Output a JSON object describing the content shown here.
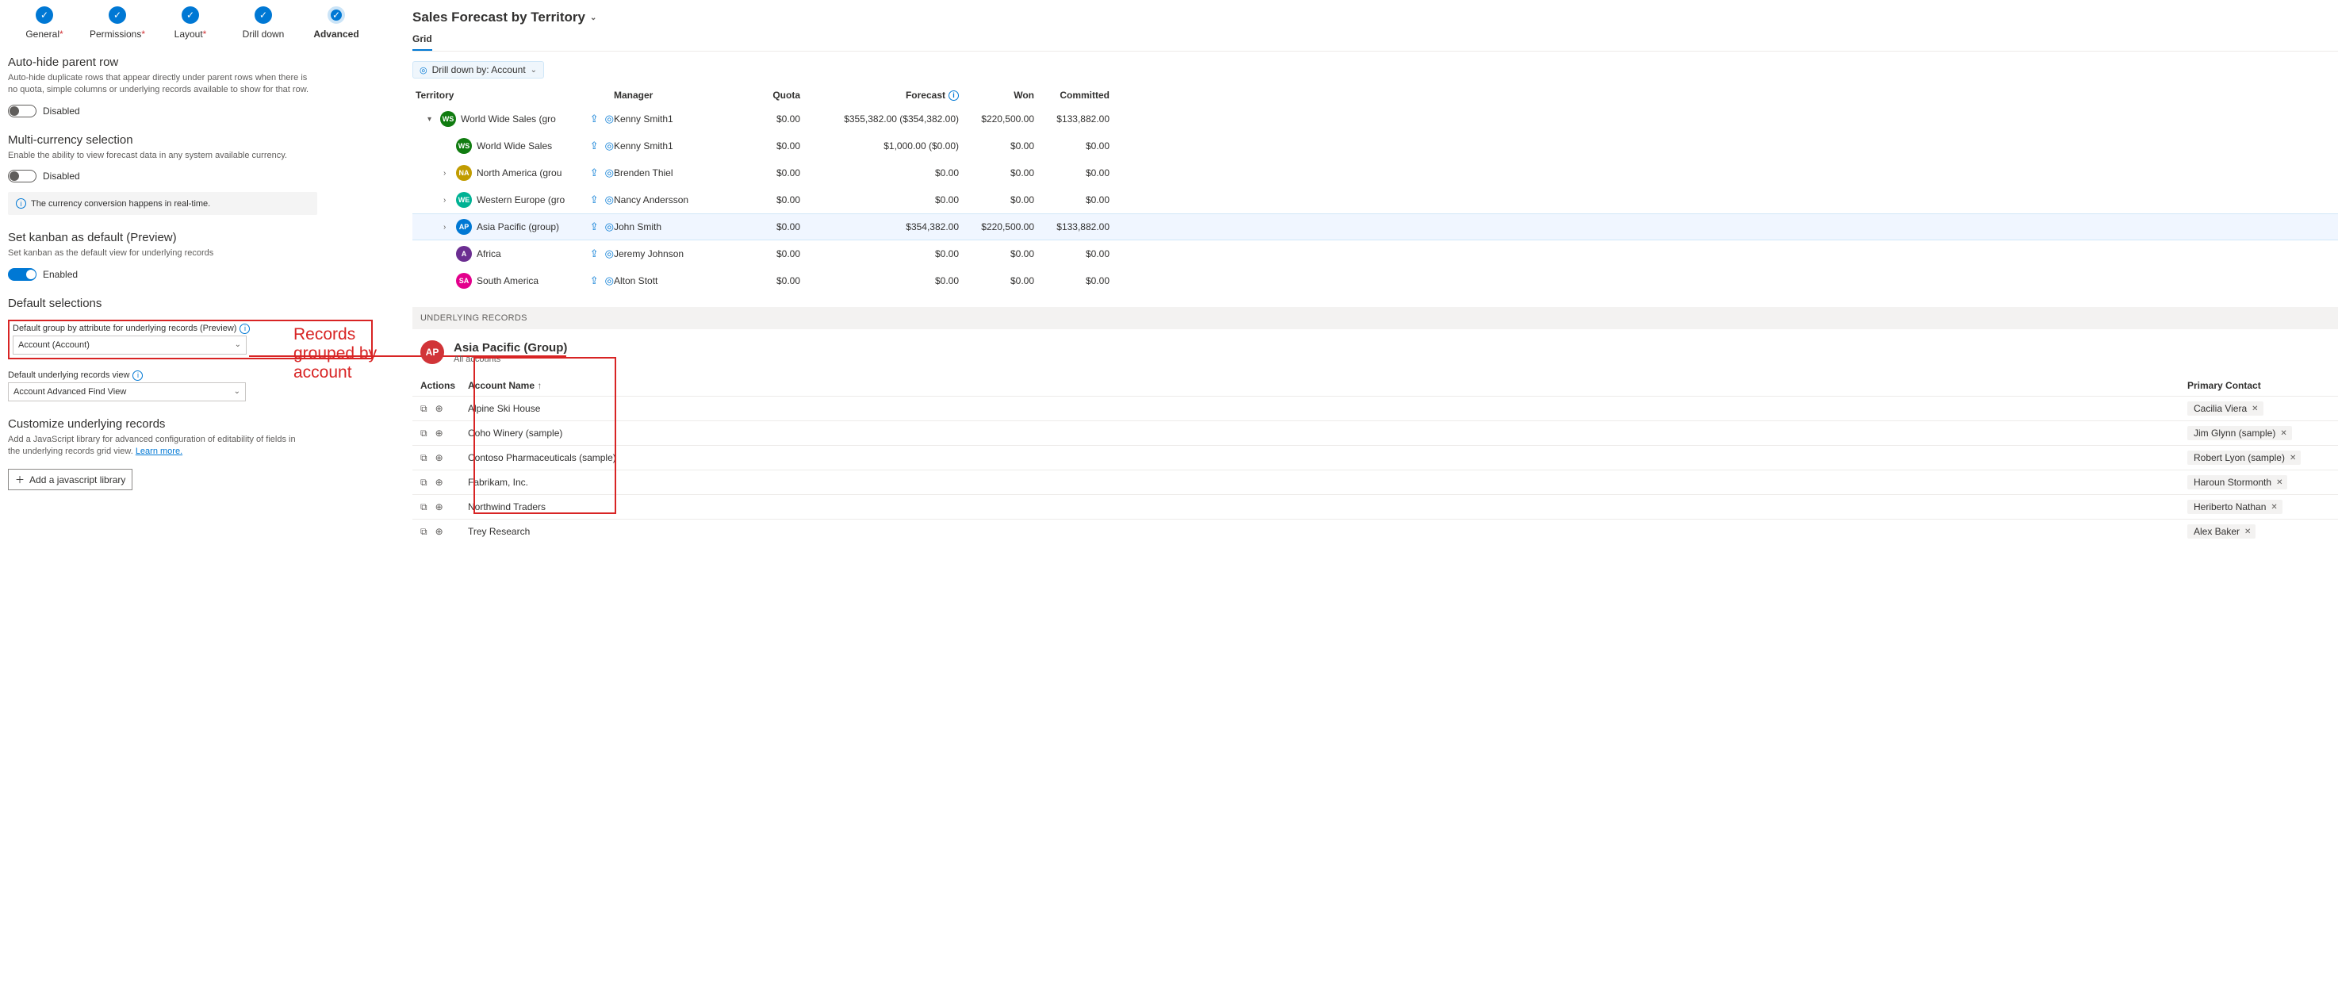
{
  "stepper": {
    "steps": [
      {
        "label": "General",
        "ast": true
      },
      {
        "label": "Permissions",
        "ast": true
      },
      {
        "label": "Layout",
        "ast": true
      },
      {
        "label": "Drill down",
        "ast": false
      },
      {
        "label": "Advanced",
        "ast": false,
        "current": true
      }
    ]
  },
  "sections": {
    "autohide": {
      "title": "Auto-hide parent row",
      "desc": "Auto-hide duplicate rows that appear directly under parent rows when there is no quota, simple columns or underlying records available to show for that row.",
      "state": "Disabled"
    },
    "multicurrency": {
      "title": "Multi-currency selection",
      "desc": "Enable the ability to view forecast data in any system available currency.",
      "state": "Disabled",
      "info": "The currency conversion happens in real-time."
    },
    "kanban": {
      "title": "Set kanban as default (Preview)",
      "desc": "Set kanban as the default view for underlying records",
      "state": "Enabled"
    },
    "defaults_title": "Default selections",
    "group_by_label": "Default group by attribute for underlying records (Preview)",
    "group_by_value": "Account (Account)",
    "view_label": "Default underlying records view",
    "view_value": "Account Advanced Find View",
    "customize": {
      "title": "Customize underlying records",
      "desc_a": "Add a JavaScript library for advanced configuration of editability of fields in the underlying records grid view. ",
      "link": "Learn more.",
      "btn": "Add a javascript library"
    }
  },
  "annotation": "Records grouped by account",
  "forecast": {
    "title": "Sales Forecast by Territory",
    "tabs": [
      "Grid"
    ],
    "drill_chip": "Drill down by: Account",
    "cols": [
      "Territory",
      "Manager",
      "Quota",
      "Forecast",
      "Won",
      "Committed"
    ],
    "rows": [
      {
        "indent": 0,
        "exp": "▾",
        "badge": "WS",
        "cls": "ws",
        "name": "World Wide Sales (group",
        "mgr": "Kenny Smith1",
        "quota": "$0.00",
        "fc": "$355,382.00  ($354,382.00)",
        "won": "$220,500.00",
        "comm": "$133,882.00"
      },
      {
        "indent": 1,
        "exp": "",
        "badge": "WS",
        "cls": "ws",
        "name": "World Wide Sales",
        "mgr": "Kenny Smith1",
        "quota": "$0.00",
        "fc": "$1,000.00  ($0.00)",
        "won": "$0.00",
        "comm": "$0.00"
      },
      {
        "indent": 1,
        "exp": "›",
        "badge": "NA",
        "cls": "na",
        "name": "North America (grou",
        "mgr": "Brenden Thiel",
        "quota": "$0.00",
        "fc": "$0.00",
        "won": "$0.00",
        "comm": "$0.00"
      },
      {
        "indent": 1,
        "exp": "›",
        "badge": "WE",
        "cls": "we",
        "name": "Western Europe (gro",
        "mgr": "Nancy Andersson",
        "quota": "$0.00",
        "fc": "$0.00",
        "won": "$0.00",
        "comm": "$0.00"
      },
      {
        "indent": 1,
        "exp": "›",
        "badge": "AP",
        "cls": "ap",
        "name": "Asia Pacific (group)",
        "mgr": "John Smith",
        "quota": "$0.00",
        "fc": "$354,382.00",
        "won": "$220,500.00",
        "comm": "$133,882.00",
        "hl": true
      },
      {
        "indent": 1,
        "exp": "",
        "badge": "A",
        "cls": "af",
        "name": "Africa",
        "mgr": "Jeremy Johnson",
        "quota": "$0.00",
        "fc": "$0.00",
        "won": "$0.00",
        "comm": "$0.00"
      },
      {
        "indent": 1,
        "exp": "",
        "badge": "SA",
        "cls": "sa",
        "name": "South America",
        "mgr": "Alton Stott",
        "quota": "$0.00",
        "fc": "$0.00",
        "won": "$0.00",
        "comm": "$0.00"
      }
    ]
  },
  "under": {
    "bar": "UNDERLYING RECORDS",
    "title": "Asia Pacific (Group)",
    "sub": "All accounts",
    "cols": {
      "actions": "Actions",
      "name": "Account Name",
      "contact": "Primary Contact"
    },
    "rows": [
      {
        "name": "Alpine Ski House",
        "contact": "Cacilia Viera"
      },
      {
        "name": "Coho Winery (sample)",
        "contact": "Jim Glynn (sample)"
      },
      {
        "name": "Contoso Pharmaceuticals (sample)",
        "contact": "Robert Lyon (sample)"
      },
      {
        "name": "Fabrikam, Inc.",
        "contact": "Haroun Stormonth"
      },
      {
        "name": "Northwind Traders",
        "contact": "Heriberto Nathan"
      },
      {
        "name": "Trey Research",
        "contact": "Alex Baker"
      }
    ]
  }
}
